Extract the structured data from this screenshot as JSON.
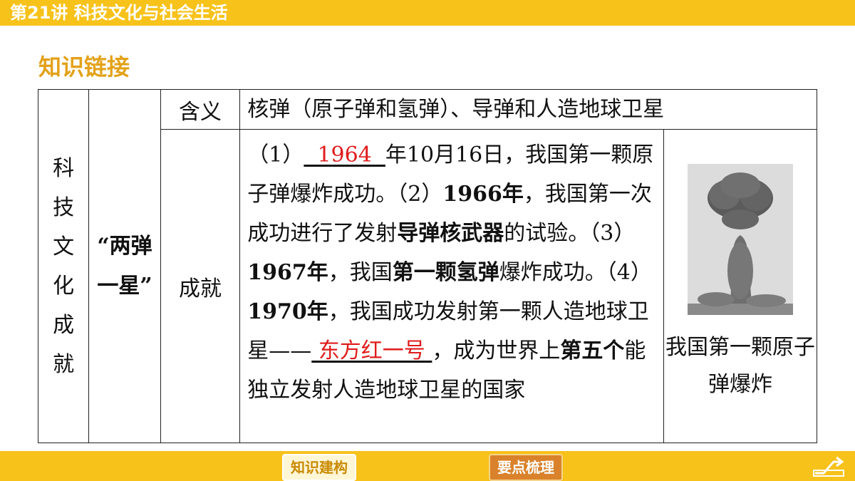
{
  "header": {
    "title": "第21讲 科技文化与社会生活"
  },
  "section": {
    "heading": "知识链接"
  },
  "table": {
    "category": "科技文化成就",
    "topic": "“两弹一星”",
    "meaning_label": "含义",
    "meaning_text": "核弹（原子弹和氢弹）、导弹和人造地球卫星",
    "achievement_label": "成就",
    "achievement": {
      "p1_prefix": "（1）",
      "p1_blank": "1964",
      "p1_text": "年10月16日，我国第一颗原子弹爆炸成功。",
      "p2_prefix": "（2）",
      "p2_year": "1966年",
      "p2_text_a": "，我国第一次成功进行了发射",
      "p2_bold": "导弹核武器",
      "p2_text_b": "的试验。",
      "p3_prefix": "（3）",
      "p3_year": "1967年",
      "p3_text_a": "，我国",
      "p3_bold": "第一颗氢弹",
      "p3_text_b": "爆炸成功。",
      "p4_prefix": "（4）",
      "p4_year": "1970年",
      "p4_text_a": "，我国成功发射第一颗人造地球卫星——",
      "p4_blank": "东方红一号",
      "p4_text_b": "，成为世界上",
      "p4_bold": "第五个",
      "p4_text_c": "能独立发射人造地球卫星的国家"
    },
    "image_caption": "我国第一颗原子弹爆炸"
  },
  "footer": {
    "build_label": "知识建构",
    "keypoints_label": "要点梳理"
  },
  "colors": {
    "bar": "#f7c21a",
    "heading": "#e3a21a",
    "blank_answer": "#e01b1b"
  }
}
